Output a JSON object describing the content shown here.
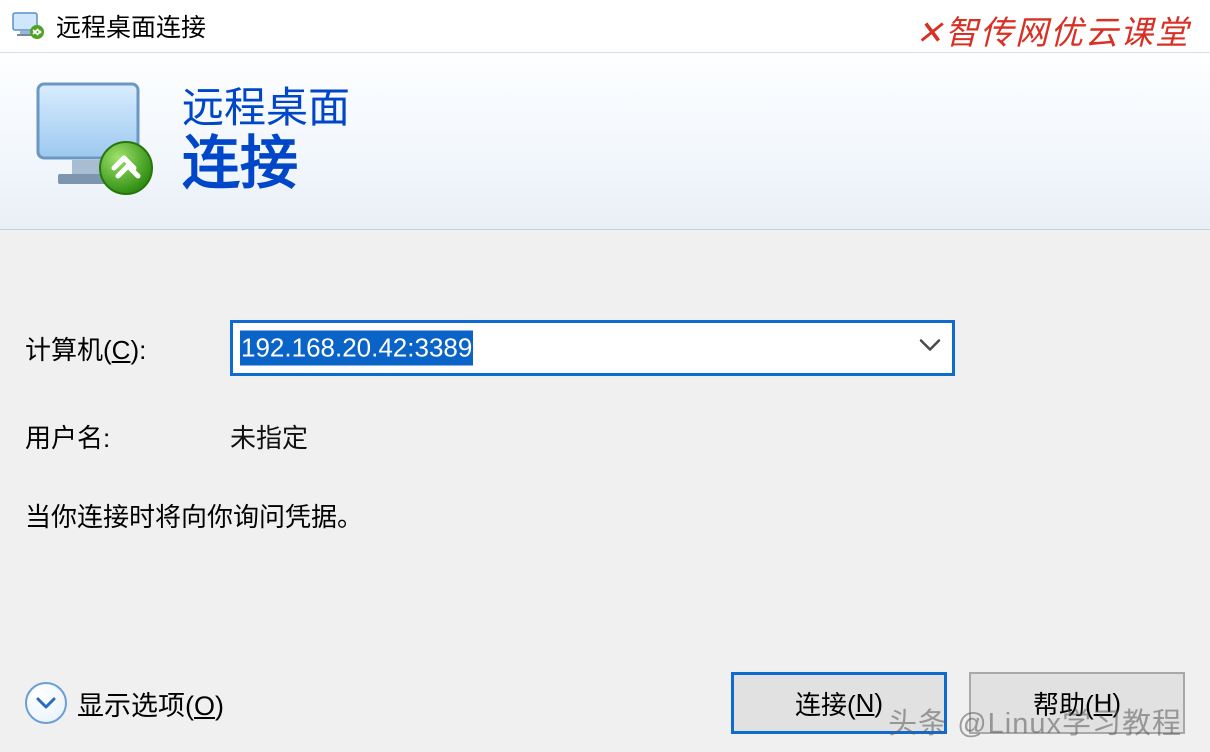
{
  "titlebar": {
    "title": "远程桌面连接"
  },
  "watermark": {
    "top": "智传网优云课堂",
    "bottom": "头条 @Linux学习教程"
  },
  "banner": {
    "line1": "远程桌面",
    "line2": "连接"
  },
  "form": {
    "computer_label": "计算机(C):",
    "computer_label_pre": "计算机(",
    "computer_label_u": "C",
    "computer_label_post": "):",
    "computer_value": "192.168.20.42:3389",
    "username_label": "用户名:",
    "username_value": "未指定",
    "hint": "当你连接时将向你询问凭据。"
  },
  "footer": {
    "options_pre": "显示选项(",
    "options_u": "O",
    "options_post": ")",
    "connect_pre": "连接(",
    "connect_u": "N",
    "connect_post": ")",
    "help_pre": "帮助(",
    "help_u": "H",
    "help_post": ")"
  }
}
